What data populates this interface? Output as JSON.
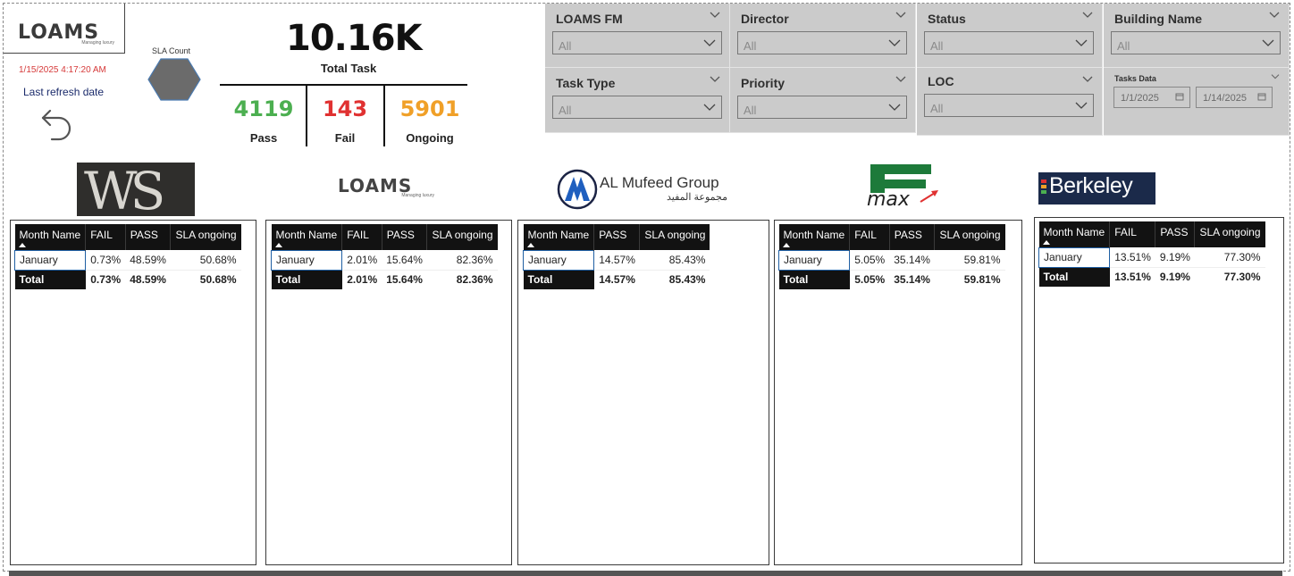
{
  "header": {
    "logo": {
      "text": "LOAMS",
      "sub": "Managing luxury"
    },
    "refresh_time": "1/15/2025 4:17:20 AM",
    "refresh_label": "Last refresh date",
    "sla_label": "SLA Count"
  },
  "kpi": {
    "total_value": "10.16K",
    "total_label": "Total Task",
    "pass_value": "4119",
    "pass_label": "Pass",
    "fail_value": "143",
    "fail_label": "Fail",
    "ongoing_value": "5901",
    "ongoing_label": "Ongoing",
    "colors": {
      "pass": "#4caf50",
      "fail": "#e03131",
      "ongoing": "#f0a028"
    }
  },
  "slicers": {
    "loams_fm": {
      "title": "LOAMS FM",
      "value": "All"
    },
    "director": {
      "title": "Director",
      "value": "All"
    },
    "status": {
      "title": "Status",
      "value": "All"
    },
    "building": {
      "title": "Building Name",
      "value": "All"
    },
    "task_type": {
      "title": "Task Type",
      "value": "All"
    },
    "priority": {
      "title": "Priority",
      "value": "All"
    },
    "loc": {
      "title": "LOC",
      "value": "All"
    },
    "tasks_data": {
      "title": "Tasks Data",
      "from": "1/1/2025",
      "to": "1/14/2025"
    }
  },
  "brands": {
    "ws": "WS",
    "loams": {
      "text": "LOAMS",
      "sub": "Managing luxury"
    },
    "almufeed": {
      "en": "AL Mufeed Group",
      "ar": "مجموعة المفيد"
    },
    "emax": {
      "text": "max"
    },
    "berkeley": {
      "text": "Berkeley"
    }
  },
  "tables": {
    "t1": {
      "headers": [
        "Month Name",
        "FAIL",
        "PASS",
        "SLA ongoing"
      ],
      "row": [
        "January",
        "0.73%",
        "48.59%",
        "50.68%"
      ],
      "total": [
        "Total",
        "0.73%",
        "48.59%",
        "50.68%"
      ]
    },
    "t2": {
      "headers": [
        "Month Name",
        "FAIL",
        "PASS",
        "SLA ongoing"
      ],
      "row": [
        "January",
        "2.01%",
        "15.64%",
        "82.36%"
      ],
      "total": [
        "Total",
        "2.01%",
        "15.64%",
        "82.36%"
      ]
    },
    "t3": {
      "headers": [
        "Month Name",
        "PASS",
        "SLA ongoing"
      ],
      "row": [
        "January",
        "14.57%",
        "85.43%"
      ],
      "total": [
        "Total",
        "14.57%",
        "85.43%"
      ]
    },
    "t4": {
      "headers": [
        "Month Name",
        "FAIL",
        "PASS",
        "SLA ongoing"
      ],
      "row": [
        "January",
        "5.05%",
        "35.14%",
        "59.81%"
      ],
      "total": [
        "Total",
        "5.05%",
        "35.14%",
        "59.81%"
      ]
    },
    "t5": {
      "headers": [
        "Month Name",
        "FAIL",
        "PASS",
        "SLA ongoing"
      ],
      "row": [
        "January",
        "13.51%",
        "9.19%",
        "77.30%"
      ],
      "total": [
        "Total",
        "13.51%",
        "9.19%",
        "77.30%"
      ]
    }
  }
}
